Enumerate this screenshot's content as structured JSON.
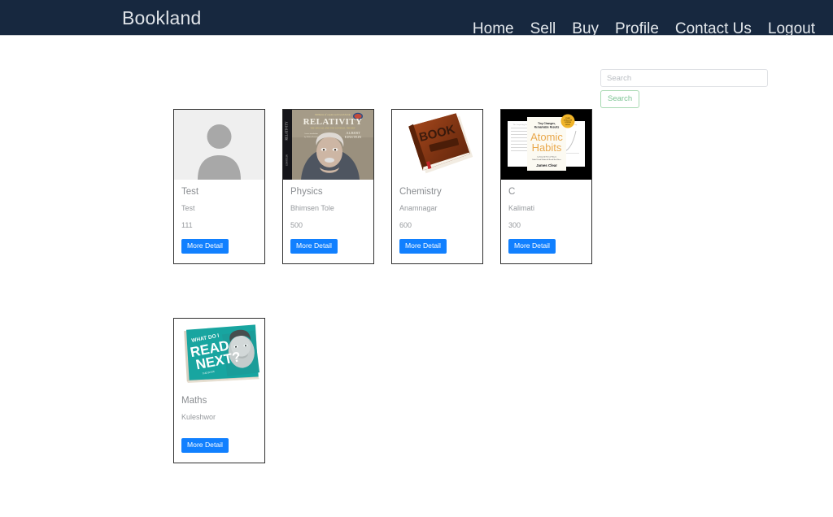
{
  "navbar": {
    "brand": "Bookland",
    "links": [
      {
        "label": "Home",
        "name": "nav-home"
      },
      {
        "label": "Sell",
        "name": "nav-sell"
      },
      {
        "label": "Buy",
        "name": "nav-buy"
      },
      {
        "label": "Profile",
        "name": "nav-profile"
      },
      {
        "label": "Contact Us",
        "name": "nav-contact-us"
      },
      {
        "label": "Logout",
        "name": "nav-logout"
      }
    ],
    "background_color": "#17283f",
    "text_color": "#e4e8ec"
  },
  "search": {
    "placeholder": "Search",
    "value": "",
    "button_label": "Search",
    "button_border_color": "#a8d9b2",
    "button_text_color": "#7cc493"
  },
  "cards": [
    {
      "title": "Test",
      "location": "Test",
      "price": "111",
      "button_label": "More Detail",
      "cover": "avatar-placeholder-image"
    },
    {
      "title": "Physics",
      "location": "Bhimsen Tole",
      "price": "500",
      "button_label": "More Detail",
      "cover": "relativity-einstein-book-cover-image",
      "cover_text": {
        "top_line": "Millions of copies sold worldwide",
        "title": "RELATIVITY",
        "subtitle": "THE SPECIAL AND THE GENERAL THEORY",
        "author": "ALBERT EINSTEIN",
        "spine": "RELATIVITY"
      }
    },
    {
      "title": "Chemistry",
      "location": "Anamnagar",
      "price": "600",
      "button_label": "More Detail",
      "cover": "brown-hardcover-book-image",
      "cover_text": {
        "title": "BOOK"
      }
    },
    {
      "title": "C",
      "location": "Kalimati",
      "price": "300",
      "button_label": "More Detail",
      "cover": "atomic-habits-book-cover-image",
      "cover_text": {
        "kicker": "Tiny Changes, Remarkable Results",
        "title_line1": "Atomic",
        "title_line2": "Habits",
        "subtitle": "An Easy & Proven Way to Build Good Habits & Break Bad Ones",
        "author": "James Clear",
        "badge": "OVER 5 MILLION COPIES SOLD"
      }
    },
    {
      "title": "Maths",
      "location": "Kuleshwor",
      "price": "",
      "button_label": "More Detail",
      "cover": "what-do-i-read-next-book-cover-image",
      "cover_text": {
        "line1": "WHAT DO I",
        "line2": "READ",
        "line3": "NEXT?",
        "line4": "THE BOOK"
      }
    }
  ],
  "theme": {
    "button_blue": "#1180ff",
    "card_border": "#2f2f2f",
    "page_background": "#ffffff"
  }
}
